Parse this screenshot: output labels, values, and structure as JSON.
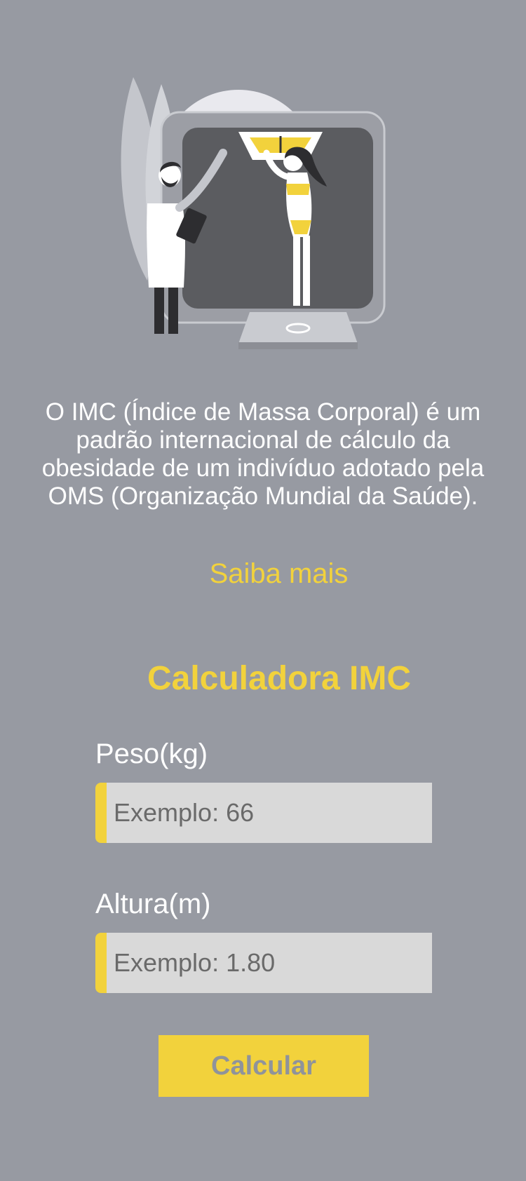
{
  "colors": {
    "background": "#979aa2",
    "accent": "#f2d23c",
    "input_background": "#d9d9d9",
    "text": "#ffffff"
  },
  "illustration": {
    "icon": "doctor-weighing-patient-illustration"
  },
  "intro": {
    "description": "O IMC (Índice de Massa Corporal) é um padrão internacional de cálculo da obesidade de um indivíduo adotado pela OMS (Organização Mundial da Saúde).",
    "learn_more": "Saiba mais"
  },
  "calculator": {
    "title": "Calculadora IMC",
    "weight": {
      "label": "Peso(kg)",
      "placeholder": "Exemplo: 66",
      "value": ""
    },
    "height": {
      "label": "Altura(m)",
      "placeholder": "Exemplo: 1.80",
      "value": ""
    },
    "submit_label": "Calcular"
  }
}
